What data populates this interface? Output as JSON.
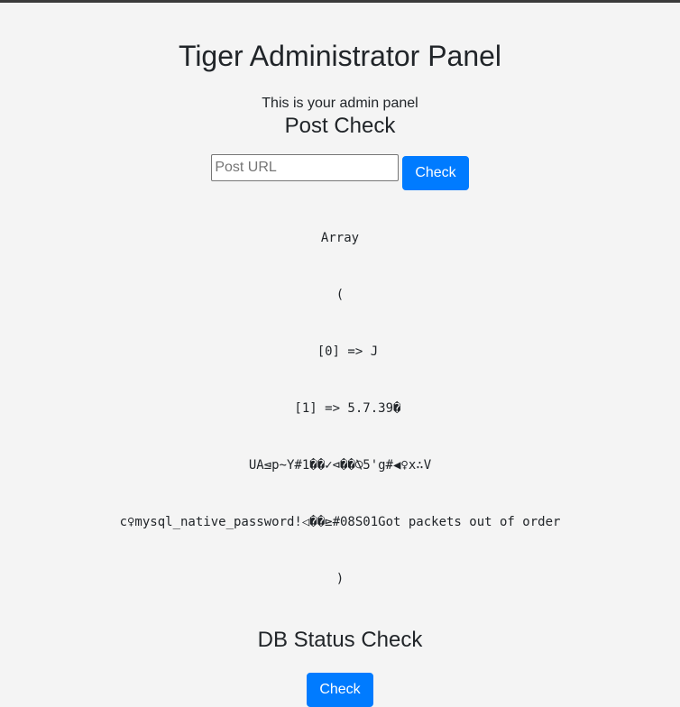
{
  "page": {
    "title": "Tiger Administrator Panel",
    "subtitle": "This is your admin panel"
  },
  "post_check": {
    "heading": "Post Check",
    "input_placeholder": "Post URL",
    "input_value": "",
    "button_label": "Check",
    "output_lines": [
      "Array",
      "(",
      "  [0] => J",
      "  [1] => 5.7.39�",
      "UA⊴p~Y#1��✓⊲��⍉5'g#◀♀x∴V",
      "c♀mysql_native_password!◁��⊵#08S01Got packets out of order",
      ")"
    ]
  },
  "db_status": {
    "heading": "DB Status Check",
    "button_label": "Check"
  },
  "colors": {
    "background": "#f4f4f4",
    "primary_button": "#007bff",
    "text": "#212529"
  }
}
